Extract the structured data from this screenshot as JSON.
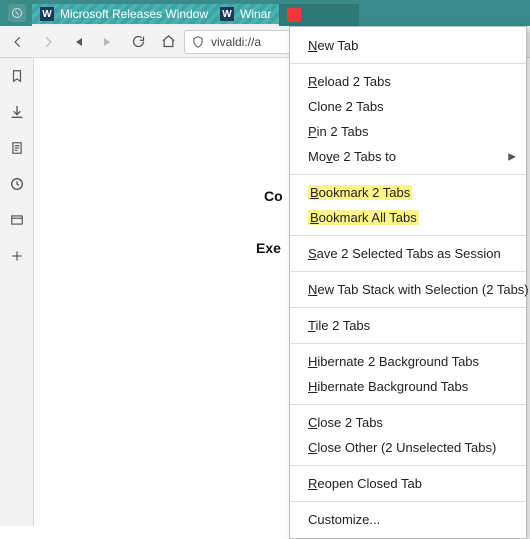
{
  "app": {
    "glyph": "V"
  },
  "tabs": [
    {
      "favicon": "W",
      "label": "Microsoft Releases Window",
      "selected": true
    },
    {
      "favicon": "W",
      "label": "Winar",
      "selected": true
    },
    {
      "favicon": "V",
      "label": "",
      "selected": false
    }
  ],
  "address": {
    "url": "vivaldi://a"
  },
  "page_text": {
    "line1": "Co",
    "line2": "Exe"
  },
  "context_menu": {
    "new_tab": {
      "pre": "",
      "u": "N",
      "post": "ew Tab"
    },
    "reload": {
      "pre": "",
      "u": "R",
      "post": "eload 2 Tabs"
    },
    "clone": {
      "pre": "Clone 2 Tabs"
    },
    "pin": {
      "pre": "",
      "u": "P",
      "post": "in 2 Tabs"
    },
    "move": {
      "pre": "Mo",
      "u": "v",
      "post": "e 2 Tabs to"
    },
    "bookmark_n": {
      "pre": "",
      "u": "B",
      "post": "ookmark 2 Tabs"
    },
    "bookmark_all": {
      "pre": "",
      "u": "B",
      "post": "ookmark All Tabs"
    },
    "save_session": {
      "pre": "",
      "u": "S",
      "post": "ave 2 Selected Tabs as Session"
    },
    "new_stack": {
      "pre": "",
      "u": "N",
      "post": "ew Tab Stack with Selection (2 Tabs)"
    },
    "tile": {
      "pre": "",
      "u": "T",
      "post": "ile 2 Tabs"
    },
    "hibernate_bg_n": {
      "pre": "",
      "u": "H",
      "post": "ibernate 2 Background Tabs"
    },
    "hibernate_bg": {
      "pre": "",
      "u": "H",
      "post": "ibernate Background Tabs"
    },
    "close_n": {
      "pre": "",
      "u": "C",
      "post": "lose 2 Tabs"
    },
    "close_other": {
      "pre": "",
      "u": "C",
      "post": "lose Other (2 Unselected Tabs)"
    },
    "reopen": {
      "pre": "",
      "u": "R",
      "post": "eopen Closed Tab"
    },
    "customize": {
      "pre": "Customize..."
    }
  }
}
